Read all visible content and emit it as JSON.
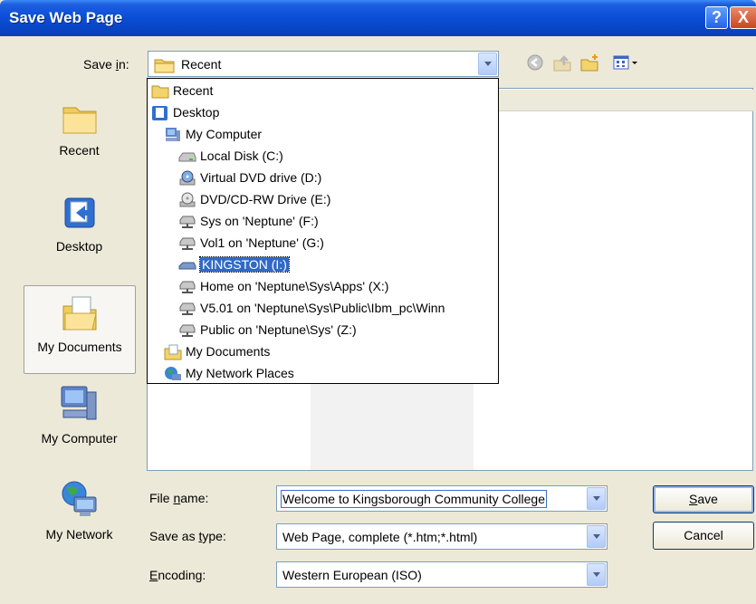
{
  "window": {
    "title": "Save Web Page",
    "help_glyph": "?",
    "close_glyph": "X"
  },
  "save_in": {
    "label_pre": "Save ",
    "label_key": "i",
    "label_post": "n:",
    "value": "Recent"
  },
  "toolbar": {
    "icons": [
      "back-icon",
      "up-folder-icon",
      "new-folder-icon",
      "views-menu-icon"
    ]
  },
  "places": [
    {
      "label": "Recent",
      "icon": "recent-folder-icon"
    },
    {
      "label": "Desktop",
      "icon": "desktop-icon"
    },
    {
      "label": "My Documents",
      "icon": "my-documents-icon",
      "selected": true
    },
    {
      "label": "My Computer",
      "icon": "my-computer-icon"
    },
    {
      "label": "My Network",
      "icon": "my-network-icon"
    }
  ],
  "dropdown": {
    "items": [
      {
        "label": "Recent",
        "icon": "folder-icon"
      },
      {
        "label": "Desktop",
        "icon": "desktop-icon"
      },
      {
        "label": "My Computer",
        "icon": "my-computer-icon"
      },
      {
        "label": "Local Disk (C:)",
        "icon": "hard-disk-icon"
      },
      {
        "label": "Virtual DVD drive (D:)",
        "icon": "dvd-drive-icon"
      },
      {
        "label": "DVD/CD-RW Drive (E:)",
        "icon": "cd-drive-icon"
      },
      {
        "label": "Sys on 'Neptune' (F:)",
        "icon": "network-drive-icon"
      },
      {
        "label": "Vol1 on 'Neptune' (G:)",
        "icon": "network-drive-icon"
      },
      {
        "label": "KINGSTON (I:)",
        "icon": "removable-drive-icon",
        "highlighted": true
      },
      {
        "label": "Home on 'Neptune\\Sys\\Apps' (X:)",
        "icon": "network-drive-icon"
      },
      {
        "label": "V5.01 on 'Neptune\\Sys\\Public\\Ibm_pc\\Winn",
        "icon": "network-drive-icon"
      },
      {
        "label": "Public on 'Neptune\\Sys' (Z:)",
        "icon": "network-drive-icon"
      },
      {
        "label": "My Documents",
        "icon": "my-documents-icon"
      },
      {
        "label": "My Network Places",
        "icon": "network-places-icon"
      }
    ]
  },
  "form": {
    "file_name": {
      "label_pre": "File ",
      "label_key": "n",
      "label_post": "ame:",
      "value": "Welcome to Kingsborough Community College"
    },
    "save_as_type": {
      "label_pre": "Save as ",
      "label_key": "t",
      "label_post": "ype:",
      "value": "Web Page, complete (*.htm;*.html)"
    },
    "encoding": {
      "label_pre": "",
      "label_key": "E",
      "label_post": "ncoding:",
      "value": "Western European (ISO)"
    }
  },
  "buttons": {
    "save": {
      "label_pre": "",
      "label_key": "S",
      "label_post": "ave"
    },
    "cancel": "Cancel"
  },
  "colors": {
    "title_bar": "#0b4fd8",
    "selection": "#316ac5",
    "dialog_bg": "#ece9d8"
  }
}
